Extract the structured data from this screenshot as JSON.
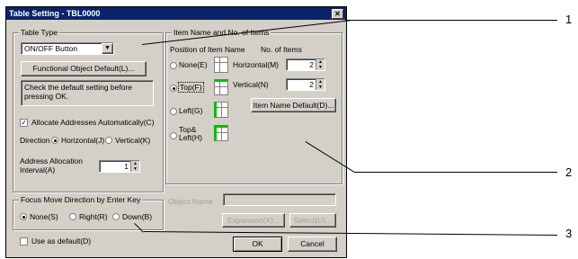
{
  "dialog": {
    "title": "Table Setting - TBL0000",
    "close_glyph": "✕"
  },
  "table_type": {
    "legend": "Table Type",
    "type_value": "ON/OFF Button",
    "functional_default_label": "Functional Object Default(L)...",
    "note": "Check the default setting before pressing OK.",
    "allocate_label": "Allocate Addresses Automatically(C)",
    "allocate_checked": true,
    "direction_label": "Direction",
    "horizontal_label": "Horizontal(J)",
    "vertical_label": "Vertical(K)",
    "interval_label_1": "Address Allocation",
    "interval_label_2": "Interval(A)",
    "interval_value": "1"
  },
  "item_name": {
    "legend": "Item Name and No. of Items",
    "position_header": "Position of Item Name",
    "count_header": "No. of Items",
    "none_label": "None(E)",
    "top_label": "Top(F)",
    "left_label": "Left(G)",
    "topleft_label_1": "Top&",
    "topleft_label_2": "Left(H)",
    "horizontal_label": "Horizontal(M)",
    "horizontal_value": "2",
    "vertical_label": "Vertical(N)",
    "vertical_value": "2",
    "item_default_label": "Item Name Default(D)..."
  },
  "focus": {
    "legend": "Focus Move Direction by Enter Key",
    "none_label": "None(S)",
    "right_label": "Right(R)",
    "down_label": "Down(B)"
  },
  "object_name": {
    "label": "Object Name",
    "value": "",
    "expansion_label": "Expansion(X)...",
    "select_label": "Select(U)..."
  },
  "footer": {
    "use_default_label": "Use as default(D)",
    "ok_label": "OK",
    "cancel_label": "Cancel"
  },
  "callouts": [
    "1",
    "2",
    "3"
  ],
  "colors": {
    "title_bar": "#0a246a",
    "face": "#d4d0c8",
    "indicator": "#00c000"
  }
}
